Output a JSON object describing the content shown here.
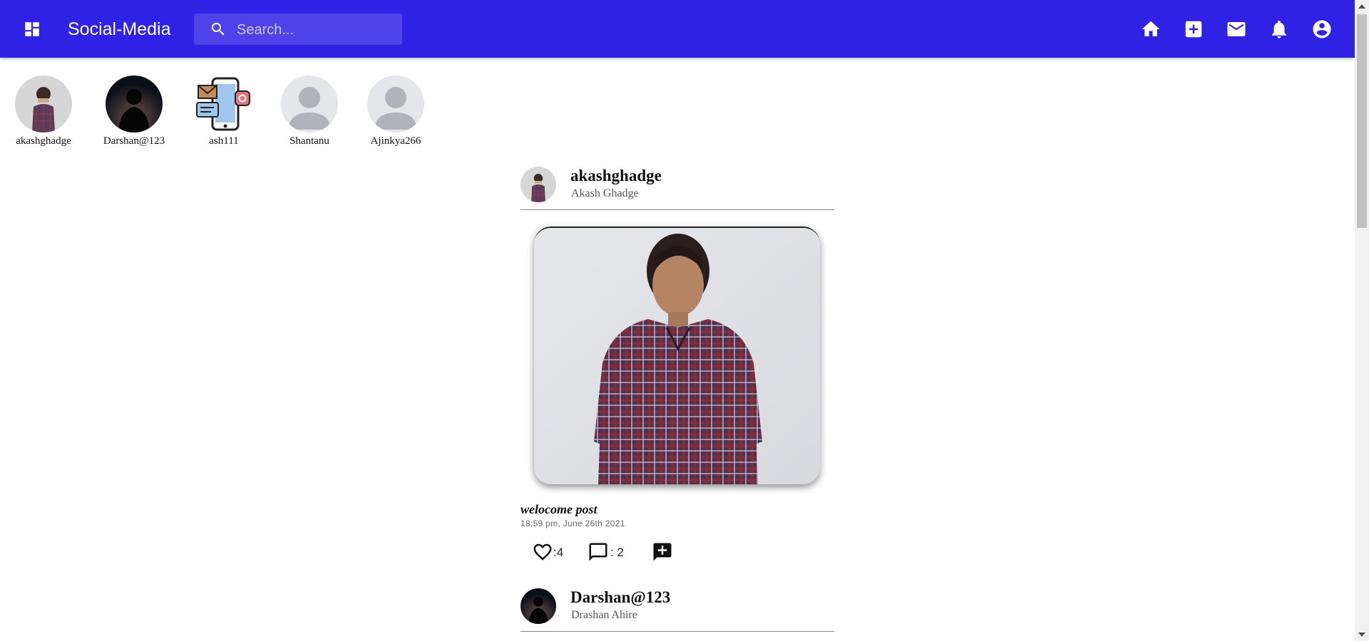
{
  "appbar": {
    "title": "Social-Media",
    "search_placeholder": "Search...",
    "icons": [
      "dashboard-icon",
      "search-icon",
      "home-icon",
      "add-box-icon",
      "mail-icon",
      "notifications-icon",
      "account-circle-icon"
    ]
  },
  "colors": {
    "appbar": "#2f22e4",
    "icon": "#ffffff"
  },
  "stories": [
    {
      "name": "akashghadge"
    },
    {
      "name": "Darshan@123"
    },
    {
      "name": "ash111"
    },
    {
      "name": "Shantanu"
    },
    {
      "name": "Ajinkya266"
    }
  ],
  "posts": [
    {
      "username": "akashghadge",
      "fullname": "Akash Ghadge",
      "caption": "welocome post",
      "time": "18:59 pm, June 26th 2021",
      "likes": ":4",
      "comments": ": 2"
    },
    {
      "username": "Darshan@123",
      "fullname": "Drashan Ahire"
    }
  ]
}
